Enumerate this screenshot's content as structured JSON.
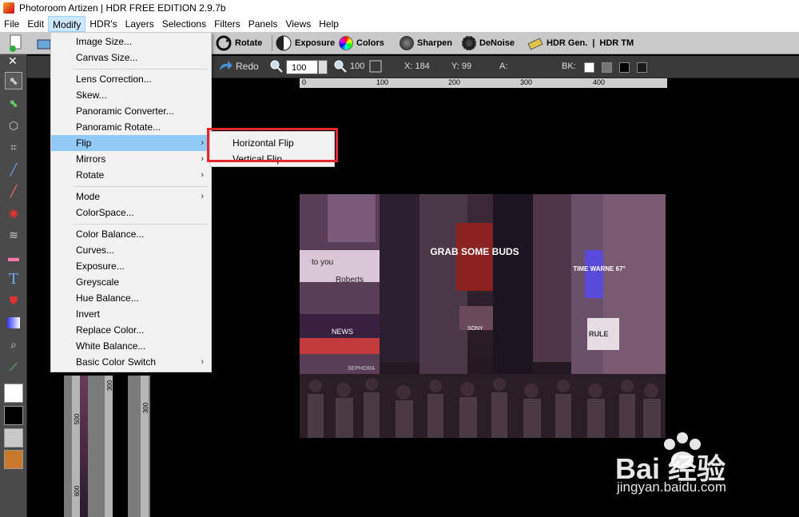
{
  "window": {
    "title": "Photoroom Artizen | HDR FREE EDITION 2.9.7b"
  },
  "menubar": [
    "File",
    "Edit",
    "Modify",
    "HDR's",
    "Layers",
    "Selections",
    "Filters",
    "Panels",
    "Views",
    "Help"
  ],
  "toolbar_top": {
    "rotate": "Rotate",
    "exposure": "Exposure",
    "colors": "Colors",
    "sharpen": "Sharpen",
    "denoise": "DeNoise",
    "hdr_gen": "HDR Gen.",
    "separator": "|",
    "hdr_tm": "HDR TM"
  },
  "toolbar_second": {
    "redo": "Redo",
    "zoom_value": "100",
    "zoom_label": "100",
    "x_readout": "X: 184",
    "y_readout": "Y: 99",
    "a_readout": "A:",
    "bk_label": "BK:"
  },
  "ruler_labels": [
    "0",
    "100",
    "200",
    "300",
    "400"
  ],
  "vertical_ruler_labels": [
    "500",
    "300",
    "300",
    "600"
  ],
  "modify_menu": {
    "items": [
      {
        "label": "Image Size..."
      },
      {
        "label": "Canvas Size..."
      },
      {
        "label": "Lens Correction..."
      },
      {
        "label": "Skew..."
      },
      {
        "label": "Panoramic Converter..."
      },
      {
        "label": "Panoramic Rotate..."
      },
      {
        "label": "Flip"
      },
      {
        "label": "Mirrors"
      },
      {
        "label": "Rotate"
      },
      {
        "label": "Mode"
      },
      {
        "label": "ColorSpace..."
      },
      {
        "label": "Color Balance..."
      },
      {
        "label": "Curves..."
      },
      {
        "label": "Exposure..."
      },
      {
        "label": "Greyscale"
      },
      {
        "label": "Hue Balance..."
      },
      {
        "label": "Invert"
      },
      {
        "label": "Replace Color..."
      },
      {
        "label": "White Balance..."
      },
      {
        "label": "Basic Color Switch"
      }
    ],
    "submenu_arrow": "›"
  },
  "flip_submenu": [
    "Horizontal Flip",
    "Vertical Flip"
  ],
  "photo_signs": {
    "budweiser": "GRAB SOME BUDS",
    "times": "TIME WARNE 67°",
    "news": "NEWS",
    "sony": "SONY",
    "roberts": "Roberts",
    "to_you": "to you",
    "sephora": "SEPHORA",
    "rule": "RULE"
  },
  "watermark": {
    "brand": "Bai 经验",
    "url": "jingyan.baidu.com"
  },
  "colors": {
    "highlight": "#91c9f7",
    "callout": "#e8262b",
    "active_menu": "#cce8ff"
  }
}
